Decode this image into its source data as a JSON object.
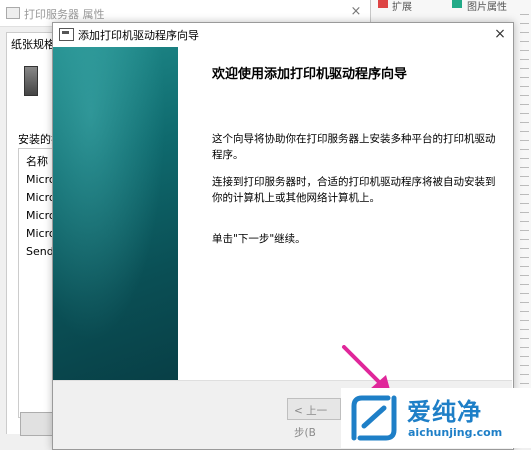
{
  "background_window": {
    "title": "打印服务器 属性",
    "close_glyph": "×",
    "tab_label": "纸张规格",
    "installed_label": "安装的打",
    "list_rows": [
      "名称",
      "Micro",
      "Micro",
      "Micro",
      "Micro",
      "Send"
    ]
  },
  "right_strip": {
    "item_a": "扩展",
    "item_b": "图片属性"
  },
  "wizard": {
    "title": "添加打印机驱动程序向导",
    "close_glyph": "×",
    "heading": "欢迎使用添加打印机驱动程序向导",
    "paragraph1": "这个向导将协助你在打印服务器上安装多种平台的打印机驱动程序。",
    "paragraph2": "连接到打印服务器时，合适的打印机驱动程序将被自动安装到你的计算机上或其他网络计算机上。",
    "paragraph3": "单击\"下一步\"继续。",
    "back_button": "< 上一步(B"
  },
  "watermark": {
    "brand_cn": "爱纯净",
    "brand_url": "aichunjing.com"
  },
  "colors": {
    "sidebar_teal": "#0f6a6e",
    "arrow_pink": "#e0279a",
    "watermark_blue": "#1e7fc7"
  }
}
